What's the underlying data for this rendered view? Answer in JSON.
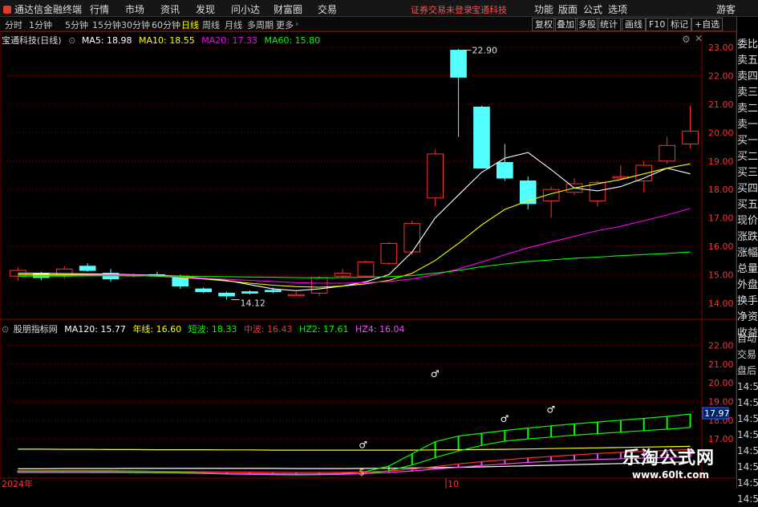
{
  "menu": {
    "app_title": "通达信金融终端",
    "items": [
      "行情",
      "市场",
      "资讯",
      "发现",
      "问小达",
      "财富圈",
      "交易"
    ],
    "notice": "证券交易未登录",
    "notice_stock": "宝通科技",
    "right_items": [
      "功能",
      "版面",
      "公式",
      "选项"
    ],
    "user": "游客"
  },
  "periods": {
    "items": [
      "分时",
      "1分钟",
      "5分钟",
      "15分钟",
      "30分钟",
      "60分钟",
      "日线",
      "周线",
      "月线",
      "多周期",
      "更多"
    ],
    "active": "日线"
  },
  "tools": [
    "复权",
    "叠加",
    "多股",
    "统计",
    "画线",
    "F10",
    "标记",
    "+自选"
  ],
  "main_legend": {
    "title": "宝通科技(日线)",
    "items": [
      {
        "label": "MA5: 18.98",
        "color": "#ffffff"
      },
      {
        "label": "MA10: 18.55",
        "color": "#ffff00"
      },
      {
        "label": "MA20: 17.33",
        "color": "#ff00ff"
      },
      {
        "label": "MA60: 15.80",
        "color": "#00ff00"
      }
    ]
  },
  "sub_legend": {
    "title": "股朋指标网",
    "items": [
      {
        "label": "MA120: 15.77",
        "color": "#ffffff"
      },
      {
        "label": "年线: 16.60",
        "color": "#ffff00"
      },
      {
        "label": "短波: 18.33",
        "color": "#00ff00"
      },
      {
        "label": "中波: 16.43",
        "color": "#ff3030"
      },
      {
        "label": "HZ2: 17.61",
        "color": "#00ff00"
      },
      {
        "label": "HZ4: 16.04",
        "color": "#ff44ff"
      }
    ]
  },
  "side_panel": {
    "top": [
      "委比",
      "卖五",
      "卖四",
      "卖三",
      "卖二",
      "卖一",
      "买一",
      "买二",
      "买三",
      "买四",
      "买五",
      "现价",
      "涨跌",
      "涨幅",
      "总量",
      "外盘",
      "换手",
      "净资",
      "收益"
    ],
    "bottom": [
      "自动",
      "交易",
      "盘后",
      "14:56",
      "14:56",
      "14:56",
      "14:56",
      "14:56",
      "14:56",
      "14:56",
      "14:56"
    ]
  },
  "x_axis_labels": [
    "2024年",
    "10"
  ],
  "watermark": {
    "line1": "乐淘公式网",
    "line2": "www.60lt.com"
  },
  "colors": {
    "up": "#ff3232",
    "down": "#54ffff",
    "grid": "#8b0000",
    "ma5": "#ffffff",
    "ma10": "#ffff00",
    "ma20": "#ff00ff",
    "ma60": "#00ff00"
  },
  "chart_data": [
    {
      "type": "candlestick",
      "title": "宝通科技(日线)",
      "ylim": [
        13.6,
        23.2
      ],
      "yticks": [
        14.0,
        15.0,
        16.0,
        17.0,
        18.0,
        19.0,
        20.0,
        21.0,
        22.0,
        23.0
      ],
      "candles": [
        {
          "o": 14.95,
          "h": 15.25,
          "l": 14.8,
          "c": 15.15
        },
        {
          "o": 15.05,
          "h": 15.1,
          "l": 14.8,
          "c": 14.9
        },
        {
          "o": 14.95,
          "h": 15.3,
          "l": 14.85,
          "c": 15.2
        },
        {
          "o": 15.3,
          "h": 15.4,
          "l": 15.1,
          "c": 15.15
        },
        {
          "o": 15.05,
          "h": 15.2,
          "l": 14.75,
          "c": 14.85
        },
        {
          "o": 14.95,
          "h": 15.05,
          "l": 14.9,
          "c": 15.0
        },
        {
          "o": 15.0,
          "h": 15.1,
          "l": 14.95,
          "c": 14.95
        },
        {
          "o": 14.95,
          "h": 15.0,
          "l": 14.5,
          "c": 14.6
        },
        {
          "o": 14.5,
          "h": 14.55,
          "l": 14.35,
          "c": 14.4
        },
        {
          "o": 14.35,
          "h": 14.4,
          "l": 14.12,
          "c": 14.25
        },
        {
          "o": 14.4,
          "h": 14.45,
          "l": 14.3,
          "c": 14.35
        },
        {
          "o": 14.45,
          "h": 14.55,
          "l": 14.35,
          "c": 14.4
        },
        {
          "o": 14.3,
          "h": 14.4,
          "l": 14.25,
          "c": 14.3
        },
        {
          "o": 14.35,
          "h": 14.95,
          "l": 14.25,
          "c": 14.9
        },
        {
          "o": 14.95,
          "h": 15.2,
          "l": 14.9,
          "c": 15.05
        },
        {
          "o": 14.95,
          "h": 15.5,
          "l": 14.9,
          "c": 15.45
        },
        {
          "o": 15.4,
          "h": 16.15,
          "l": 15.35,
          "c": 16.1
        },
        {
          "o": 15.8,
          "h": 16.9,
          "l": 15.7,
          "c": 16.8
        },
        {
          "o": 17.7,
          "h": 19.4,
          "l": 17.4,
          "c": 19.25
        },
        {
          "o": 22.9,
          "h": 22.95,
          "l": 19.85,
          "c": 21.95
        },
        {
          "o": 20.9,
          "h": 20.95,
          "l": 18.75,
          "c": 18.75
        },
        {
          "o": 18.95,
          "h": 19.6,
          "l": 18.3,
          "c": 18.4
        },
        {
          "o": 18.3,
          "h": 18.45,
          "l": 17.3,
          "c": 17.5
        },
        {
          "o": 17.6,
          "h": 18.1,
          "l": 17.0,
          "c": 18.0
        },
        {
          "o": 17.9,
          "h": 18.4,
          "l": 17.8,
          "c": 18.2
        },
        {
          "o": 17.6,
          "h": 18.3,
          "l": 17.4,
          "c": 18.25
        },
        {
          "o": 18.4,
          "h": 18.85,
          "l": 18.35,
          "c": 18.45
        },
        {
          "o": 18.3,
          "h": 19.0,
          "l": 17.9,
          "c": 18.85
        },
        {
          "o": 19.0,
          "h": 19.85,
          "l": 18.9,
          "c": 19.55
        },
        {
          "o": 19.6,
          "h": 20.95,
          "l": 19.45,
          "c": 20.05
        }
      ],
      "annotations": [
        {
          "label": "22.90",
          "value": 22.9,
          "index": 19
        },
        {
          "label": "14.12",
          "value": 14.12,
          "index": 9
        }
      ],
      "series": [
        {
          "name": "MA5",
          "color": "#ffffff",
          "values": [
            15.05,
            15.05,
            15.04,
            15.03,
            15.02,
            15.0,
            14.98,
            14.95,
            14.88,
            14.8,
            14.65,
            14.5,
            14.44,
            14.5,
            14.6,
            14.75,
            15.0,
            15.8,
            17.0,
            17.8,
            18.6,
            19.1,
            19.3,
            18.7,
            18.05,
            17.95,
            18.1,
            18.4,
            18.75,
            18.55
          ]
        },
        {
          "name": "MA10",
          "color": "#ffff00",
          "values": [
            15.0,
            15.0,
            15.0,
            15.0,
            15.0,
            14.98,
            14.95,
            14.9,
            14.85,
            14.78,
            14.7,
            14.63,
            14.58,
            14.56,
            14.6,
            14.68,
            14.8,
            15.05,
            15.5,
            16.1,
            16.75,
            17.3,
            17.6,
            17.85,
            18.05,
            18.2,
            18.35,
            18.55,
            18.75,
            18.9
          ]
        },
        {
          "name": "MA20",
          "color": "#ff00ff",
          "values": [
            14.95,
            14.96,
            14.97,
            14.98,
            14.99,
            14.98,
            14.96,
            14.92,
            14.88,
            14.84,
            14.8,
            14.76,
            14.72,
            14.7,
            14.7,
            14.72,
            14.76,
            14.85,
            15.0,
            15.2,
            15.45,
            15.7,
            15.95,
            16.15,
            16.35,
            16.55,
            16.7,
            16.9,
            17.1,
            17.33
          ]
        },
        {
          "name": "MA60",
          "color": "#00ff00",
          "values": [
            14.95,
            14.95,
            14.95,
            14.96,
            14.96,
            14.96,
            14.96,
            14.95,
            14.94,
            14.93,
            14.92,
            14.91,
            14.9,
            14.89,
            14.9,
            14.91,
            14.93,
            14.97,
            15.05,
            15.15,
            15.28,
            15.38,
            15.46,
            15.52,
            15.58,
            15.62,
            15.67,
            15.71,
            15.75,
            15.8
          ]
        }
      ]
    },
    {
      "type": "line",
      "title": "股朋指标网",
      "ylim": [
        14.9,
        23.4
      ],
      "yticks": [
        17.0,
        18.0,
        19.0,
        20.0,
        21.0,
        22.0
      ],
      "last_value_label": "17.97",
      "markers": [
        {
          "symbol": "♂",
          "index": 18.3,
          "value": 20.3
        },
        {
          "symbol": "♂",
          "index": 15.2,
          "value": 16.5
        },
        {
          "symbol": "♂",
          "index": 21.3,
          "value": 17.9
        },
        {
          "symbol": "♂",
          "index": 23.3,
          "value": 18.4
        },
        {
          "symbol": "$",
          "index": 15.2,
          "value": 15.05
        }
      ],
      "series": [
        {
          "name": "年线",
          "color": "#ffff00",
          "values": [
            16.45,
            16.45,
            16.44,
            16.44,
            16.43,
            16.43,
            16.42,
            16.42,
            16.42,
            16.41,
            16.41,
            16.4,
            16.4,
            16.4,
            16.4,
            16.4,
            16.4,
            16.4,
            16.41,
            16.42,
            16.43,
            16.44,
            16.46,
            16.48,
            16.5,
            16.52,
            16.54,
            16.56,
            16.58,
            16.6
          ]
        },
        {
          "name": "MA120",
          "color": "#ffffff",
          "values": [
            15.4,
            15.4,
            15.41,
            15.41,
            15.41,
            15.42,
            15.42,
            15.42,
            15.42,
            15.42,
            15.42,
            15.42,
            15.41,
            15.41,
            15.41,
            15.42,
            15.43,
            15.44,
            15.46,
            15.48,
            15.5,
            15.53,
            15.56,
            15.59,
            15.62,
            15.65,
            15.68,
            15.71,
            15.74,
            15.77
          ]
        },
        {
          "name": "短波",
          "color": "#00ff00",
          "values": [
            15.3,
            15.3,
            15.3,
            15.3,
            15.3,
            15.28,
            15.26,
            15.22,
            15.18,
            15.14,
            15.12,
            15.1,
            15.1,
            15.12,
            15.15,
            15.25,
            15.55,
            16.2,
            16.85,
            17.15,
            17.3,
            17.45,
            17.58,
            17.7,
            17.8,
            17.9,
            18.0,
            18.1,
            18.2,
            18.33
          ]
        },
        {
          "name": "HZ2",
          "color": "#00ff00",
          "values": [
            15.25,
            15.25,
            15.25,
            15.25,
            15.24,
            15.22,
            15.2,
            15.18,
            15.15,
            15.12,
            15.1,
            15.08,
            15.07,
            15.08,
            15.1,
            15.15,
            15.3,
            15.6,
            16.0,
            16.35,
            16.65,
            16.88,
            17.0,
            17.1,
            17.2,
            17.28,
            17.36,
            17.44,
            17.52,
            17.61
          ]
        },
        {
          "name": "中波",
          "color": "#ff3030",
          "values": [
            15.28,
            15.28,
            15.28,
            15.28,
            15.28,
            15.27,
            15.26,
            15.25,
            15.24,
            15.23,
            15.22,
            15.21,
            15.2,
            15.2,
            15.21,
            15.23,
            15.28,
            15.38,
            15.52,
            15.66,
            15.78,
            15.88,
            15.98,
            16.06,
            16.14,
            16.22,
            16.28,
            16.33,
            16.38,
            16.43
          ]
        },
        {
          "name": "HZ4",
          "color": "#ff44ff",
          "values": [
            15.2,
            15.2,
            15.2,
            15.2,
            15.2,
            15.19,
            15.18,
            15.17,
            15.16,
            15.15,
            15.14,
            15.13,
            15.12,
            15.12,
            15.13,
            15.15,
            15.2,
            15.28,
            15.38,
            15.48,
            15.58,
            15.66,
            15.74,
            15.8,
            15.85,
            15.9,
            15.94,
            15.97,
            16.0,
            16.04
          ]
        }
      ]
    }
  ]
}
